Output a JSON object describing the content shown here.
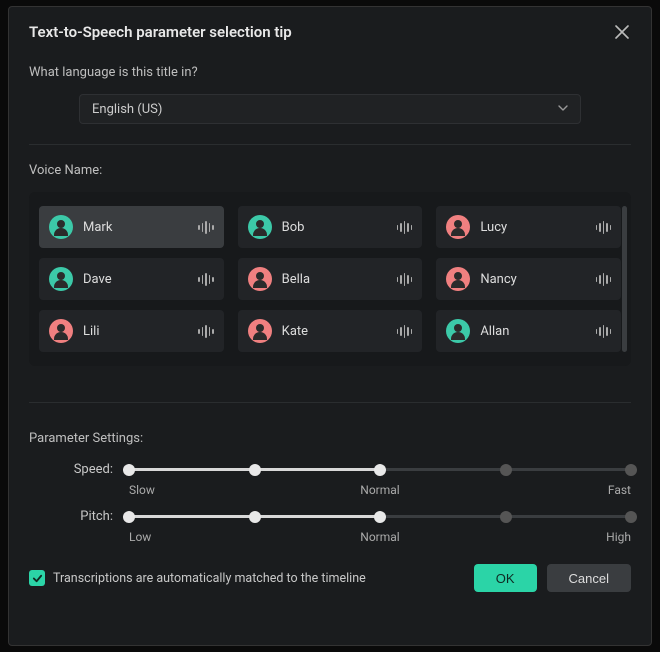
{
  "header": {
    "title": "Text-to-Speech parameter selection tip"
  },
  "language": {
    "label": "What language is this title in?",
    "selected": "English (US)"
  },
  "voice": {
    "label": "Voice Name:",
    "items": [
      {
        "name": "Mark",
        "gender": "m",
        "selected": true
      },
      {
        "name": "Bob",
        "gender": "m",
        "selected": false
      },
      {
        "name": "Lucy",
        "gender": "f",
        "selected": false
      },
      {
        "name": "Dave",
        "gender": "m",
        "selected": false
      },
      {
        "name": "Bella",
        "gender": "f",
        "selected": false
      },
      {
        "name": "Nancy",
        "gender": "f",
        "selected": false
      },
      {
        "name": "Lili",
        "gender": "f",
        "selected": false
      },
      {
        "name": "Kate",
        "gender": "f",
        "selected": false
      },
      {
        "name": "Allan",
        "gender": "m",
        "selected": false
      }
    ]
  },
  "params": {
    "label": "Parameter Settings:",
    "speed": {
      "label": "Speed:",
      "low": "Slow",
      "mid": "Normal",
      "high": "Fast",
      "value_pct": 50
    },
    "pitch": {
      "label": "Pitch:",
      "low": "Low",
      "mid": "Normal",
      "high": "High",
      "value_pct": 50
    }
  },
  "footer": {
    "checkbox_label": "Transcriptions are automatically matched to the timeline",
    "checked": true,
    "ok_label": "OK",
    "cancel_label": "Cancel"
  },
  "colors": {
    "accent": "#2bd4a7",
    "bg": "#1a1c1e",
    "card": "#222427"
  }
}
